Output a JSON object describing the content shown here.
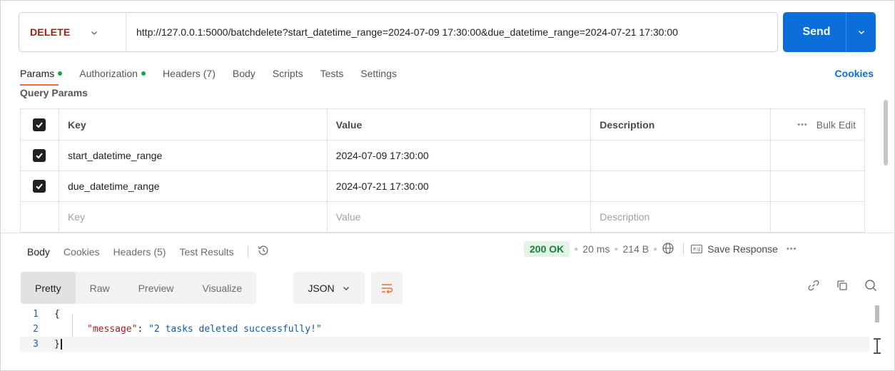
{
  "request": {
    "method": "DELETE",
    "url": "http://127.0.0.1:5000/batchdelete?start_datetime_range=2024-07-09 17:30:00&due_datetime_range=2024-07-21 17:30:00",
    "send_label": "Send"
  },
  "request_tabs": [
    {
      "label": "Params",
      "dot": true,
      "active": true
    },
    {
      "label": "Authorization",
      "dot": true
    },
    {
      "label": "Headers (7)"
    },
    {
      "label": "Body"
    },
    {
      "label": "Scripts"
    },
    {
      "label": "Tests"
    },
    {
      "label": "Settings"
    }
  ],
  "cookies_label": "Cookies",
  "query_params": {
    "title": "Query Params",
    "headers": {
      "key": "Key",
      "value": "Value",
      "description": "Description",
      "bulk_edit": "Bulk Edit"
    },
    "rows": [
      {
        "checked": true,
        "key": "start_datetime_range",
        "value": "2024-07-09 17:30:00",
        "description": ""
      },
      {
        "checked": true,
        "key": "due_datetime_range",
        "value": "2024-07-21 17:30:00",
        "description": ""
      }
    ],
    "placeholder": {
      "key": "Key",
      "value": "Value",
      "description": "Description"
    }
  },
  "response_tabs": [
    {
      "label": "Body",
      "active": true
    },
    {
      "label": "Cookies"
    },
    {
      "label": "Headers (5)"
    },
    {
      "label": "Test Results"
    }
  ],
  "response_meta": {
    "status": "200 OK",
    "time": "20 ms",
    "size": "214 B",
    "save_response": "Save Response"
  },
  "view_modes": [
    {
      "label": "Pretty",
      "active": true
    },
    {
      "label": "Raw"
    },
    {
      "label": "Preview"
    },
    {
      "label": "Visualize"
    }
  ],
  "format": "JSON",
  "code": {
    "line_numbers": [
      "1",
      "2",
      "3"
    ],
    "open_brace": "{",
    "close_brace": "}",
    "key": "\"message\"",
    "sep": ": ",
    "value": "\"2 tasks deleted successfully!\""
  },
  "colors": {
    "accent": "#0c6fd9",
    "method": "#b01818",
    "status_bg": "#e3f3e7",
    "status_fg": "#1a7f3a",
    "tab_underline": "#ef6c39"
  }
}
